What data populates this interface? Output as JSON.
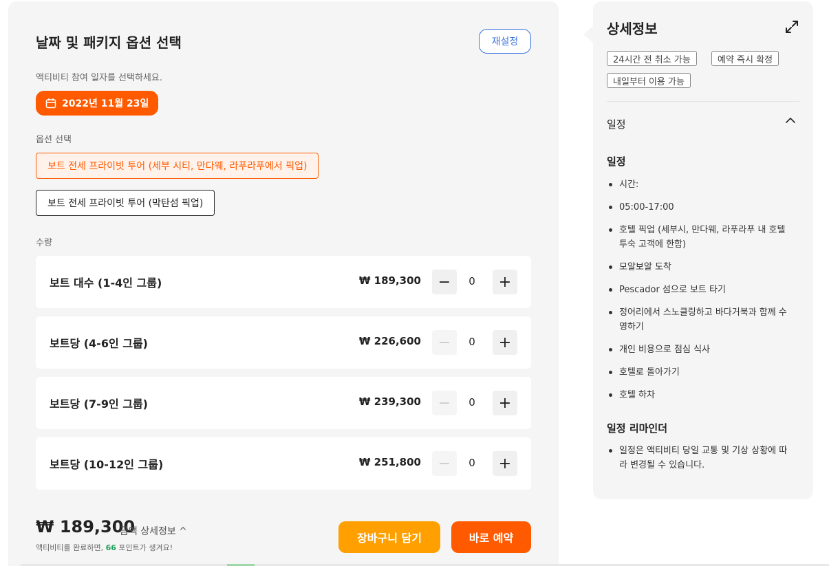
{
  "booking": {
    "title": "날짜 및 패키지 옵션 선택",
    "reset_label": "재설정",
    "date_help": "액티비티 참여 일자를 선택하세요.",
    "date_value": "2022년 11월 23일",
    "option_label": "옵션 선택",
    "options": [
      {
        "label": "보트 전세 프라이빗 투어 (세부 시티, 만다웨, 라푸라푸에서 픽업)",
        "selected": true
      },
      {
        "label": "보트 전세 프라이빗 투어 (막탄섬 픽업)",
        "selected": false
      }
    ],
    "quantity_label": "수량",
    "rows": [
      {
        "name": "보트 대수 (1-4인 그룹)",
        "price": "₩ 189,300",
        "qty": "0"
      },
      {
        "name": "보트당 (4-6인 그룹)",
        "price": "₩ 226,600",
        "qty": "0"
      },
      {
        "name": "보트당 (7-9인 그룹)",
        "price": "₩ 239,300",
        "qty": "0"
      },
      {
        "name": "보트당 (10-12인 그룹)",
        "price": "₩ 251,800",
        "qty": "0"
      }
    ],
    "minus_symbol": "−",
    "plus_symbol": "+",
    "total_price": "₩ 189,300",
    "price_detail": "금액 상세정보 ^",
    "points_prefix": "액티비티를 완료하면,",
    "points_value": "66",
    "points_suffix": "포인트가 생겨요!",
    "cart_label": "장바구니 담기",
    "book_label": "바로 예약"
  },
  "details": {
    "title": "상세정보",
    "tags": [
      "24시간 전 취소 가능",
      "예약 즉시 확정",
      "내일부터 이용 가능"
    ],
    "section_title": "일정",
    "schedule_title": "일정",
    "schedule_items": [
      "시간:",
      "05:00-17:00",
      "호텔 픽업 (세부시, 만다웨, 라푸라푸 내 호텔 투숙 고객에 한함)",
      "모알보알 도착",
      "Pescador 섬으로 보트 타기",
      "정어리에서 스노클링하고 바다거북과 함께 수영하기",
      "개인 비용으로 점심 식사",
      "호텔로 돌아가기",
      "호텔 하차"
    ],
    "reminder_title": "일정 리마인더",
    "reminder_items": [
      "일정은 액티비티 당일 교통 및 기상 상황에 따라 변경될 수 있습니다."
    ]
  },
  "colors": {
    "accent": "#ff5a00",
    "cart": "#ff9f00",
    "link_blue": "#3b73e0",
    "points_green": "#1aa05a"
  },
  "icons": {
    "date": "calendar-icon",
    "expand": "expand-icon",
    "collapse": "chevron-up-icon"
  }
}
